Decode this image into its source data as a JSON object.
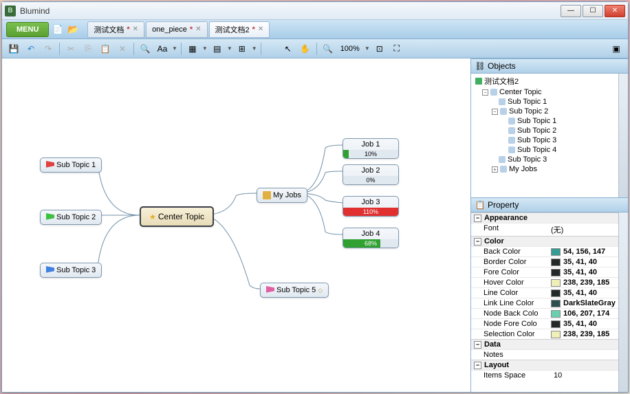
{
  "app": {
    "title": "Blumind",
    "icon_letter": "B"
  },
  "win": {
    "min": "—",
    "max": "☐",
    "close": "✕"
  },
  "menubar": {
    "menu_label": "MENU"
  },
  "tabs": [
    {
      "label": "测试文档",
      "modified": "*"
    },
    {
      "label": "one_piece",
      "modified": "*"
    },
    {
      "label": "测试文档2",
      "modified": "*"
    }
  ],
  "toolbar": {
    "zoom": "100%"
  },
  "nodes": {
    "center": "Center Topic",
    "sub1": "Sub Topic 1",
    "sub2": "Sub Topic 2",
    "sub3": "Sub Topic 3",
    "myjobs": "My Jobs",
    "sub5": "Sub Topic 5"
  },
  "jobs": [
    {
      "title": "Job 1",
      "pct": "10%",
      "fill": 10,
      "color": "#30a030"
    },
    {
      "title": "Job 2",
      "pct": "0%",
      "fill": 0,
      "color": "#30a030"
    },
    {
      "title": "Job 3",
      "pct": "110%",
      "fill": 100,
      "color": "#e03030",
      "x": true
    },
    {
      "title": "Job 4",
      "pct": "68%",
      "fill": 68,
      "color": "#30a030"
    }
  ],
  "objects_panel": {
    "title": "Objects",
    "doc": "测试文档2",
    "root": "Center Topic",
    "items": [
      "Sub Topic 1",
      "Sub Topic 2",
      "Sub Topic 1",
      "Sub Topic 2",
      "Sub Topic 3",
      "Sub Topic 4",
      "Sub Topic 3",
      "My Jobs"
    ]
  },
  "property_panel": {
    "title": "Property",
    "groups": {
      "appearance": "Appearance",
      "color": "Color",
      "data": "Data",
      "layout": "Layout"
    },
    "rows": {
      "font": {
        "k": "Font",
        "v": "(无)"
      },
      "back": {
        "k": "Back Color",
        "v": "54, 156, 147",
        "c": "#369c93"
      },
      "border": {
        "k": "Border Color",
        "v": "35, 41, 40",
        "c": "#232928"
      },
      "fore": {
        "k": "Fore Color",
        "v": "35, 41, 40",
        "c": "#232928"
      },
      "hover": {
        "k": "Hover Color",
        "v": "238, 239, 185",
        "c": "#eeefb9"
      },
      "line": {
        "k": "Line Color",
        "v": "35, 41, 40",
        "c": "#232928"
      },
      "linkline": {
        "k": "Link Line Color",
        "v": "DarkSlateGray",
        "c": "#2f4f4f"
      },
      "nodeback": {
        "k": "Node Back Colo",
        "v": "106, 207, 174",
        "c": "#6acfae"
      },
      "nodefore": {
        "k": "Node Fore Colo",
        "v": "35, 41, 40",
        "c": "#232928"
      },
      "selection": {
        "k": "Selection Color",
        "v": "238, 239, 185",
        "c": "#eeefb9"
      },
      "notes": {
        "k": "Notes",
        "v": ""
      },
      "itemsspace": {
        "k": "Items Space",
        "v": "10"
      }
    }
  }
}
